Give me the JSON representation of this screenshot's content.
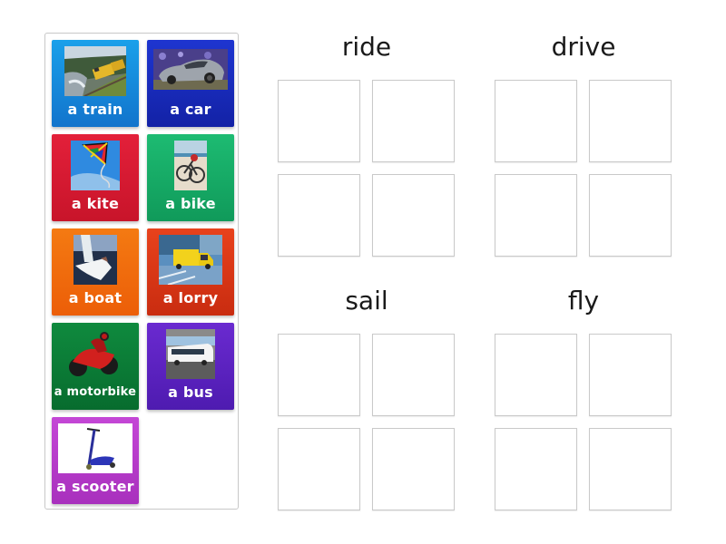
{
  "activity": {
    "type": "group sort",
    "cards": [
      {
        "label": "a train",
        "image": "train-photo",
        "color_top": "#1aa0ea",
        "color_bottom": "#1274cc"
      },
      {
        "label": "a car",
        "image": "car-photo",
        "color_top": "#1e35d0",
        "color_bottom": "#1322a6"
      },
      {
        "label": "a kite",
        "image": "kite-photo",
        "color_top": "#e3203a",
        "color_bottom": "#c8142a"
      },
      {
        "label": "a bike",
        "image": "bike-photo",
        "color_top": "#1dbb72",
        "color_bottom": "#109a5a"
      },
      {
        "label": "a boat",
        "image": "boat-photo",
        "color_top": "#f47a12",
        "color_bottom": "#ec5e08"
      },
      {
        "label": "a lorry",
        "image": "lorry-photo",
        "color_top": "#e8421c",
        "color_bottom": "#c92c10"
      },
      {
        "label": "a motorbike",
        "image": "motorbike-photo",
        "color_top": "#0f8a3e",
        "color_bottom": "#076c2e"
      },
      {
        "label": "a bus",
        "image": "bus-photo",
        "color_top": "#6a2ad0",
        "color_bottom": "#4e1bb0"
      },
      {
        "label": "a scooter",
        "image": "scooter-photo",
        "color_top": "#c447d6",
        "color_bottom": "#a830bd"
      }
    ],
    "categories": [
      {
        "title": "ride",
        "slots": 4
      },
      {
        "title": "drive",
        "slots": 4
      },
      {
        "title": "sail",
        "slots": 4
      },
      {
        "title": "fly",
        "slots": 4
      }
    ]
  }
}
